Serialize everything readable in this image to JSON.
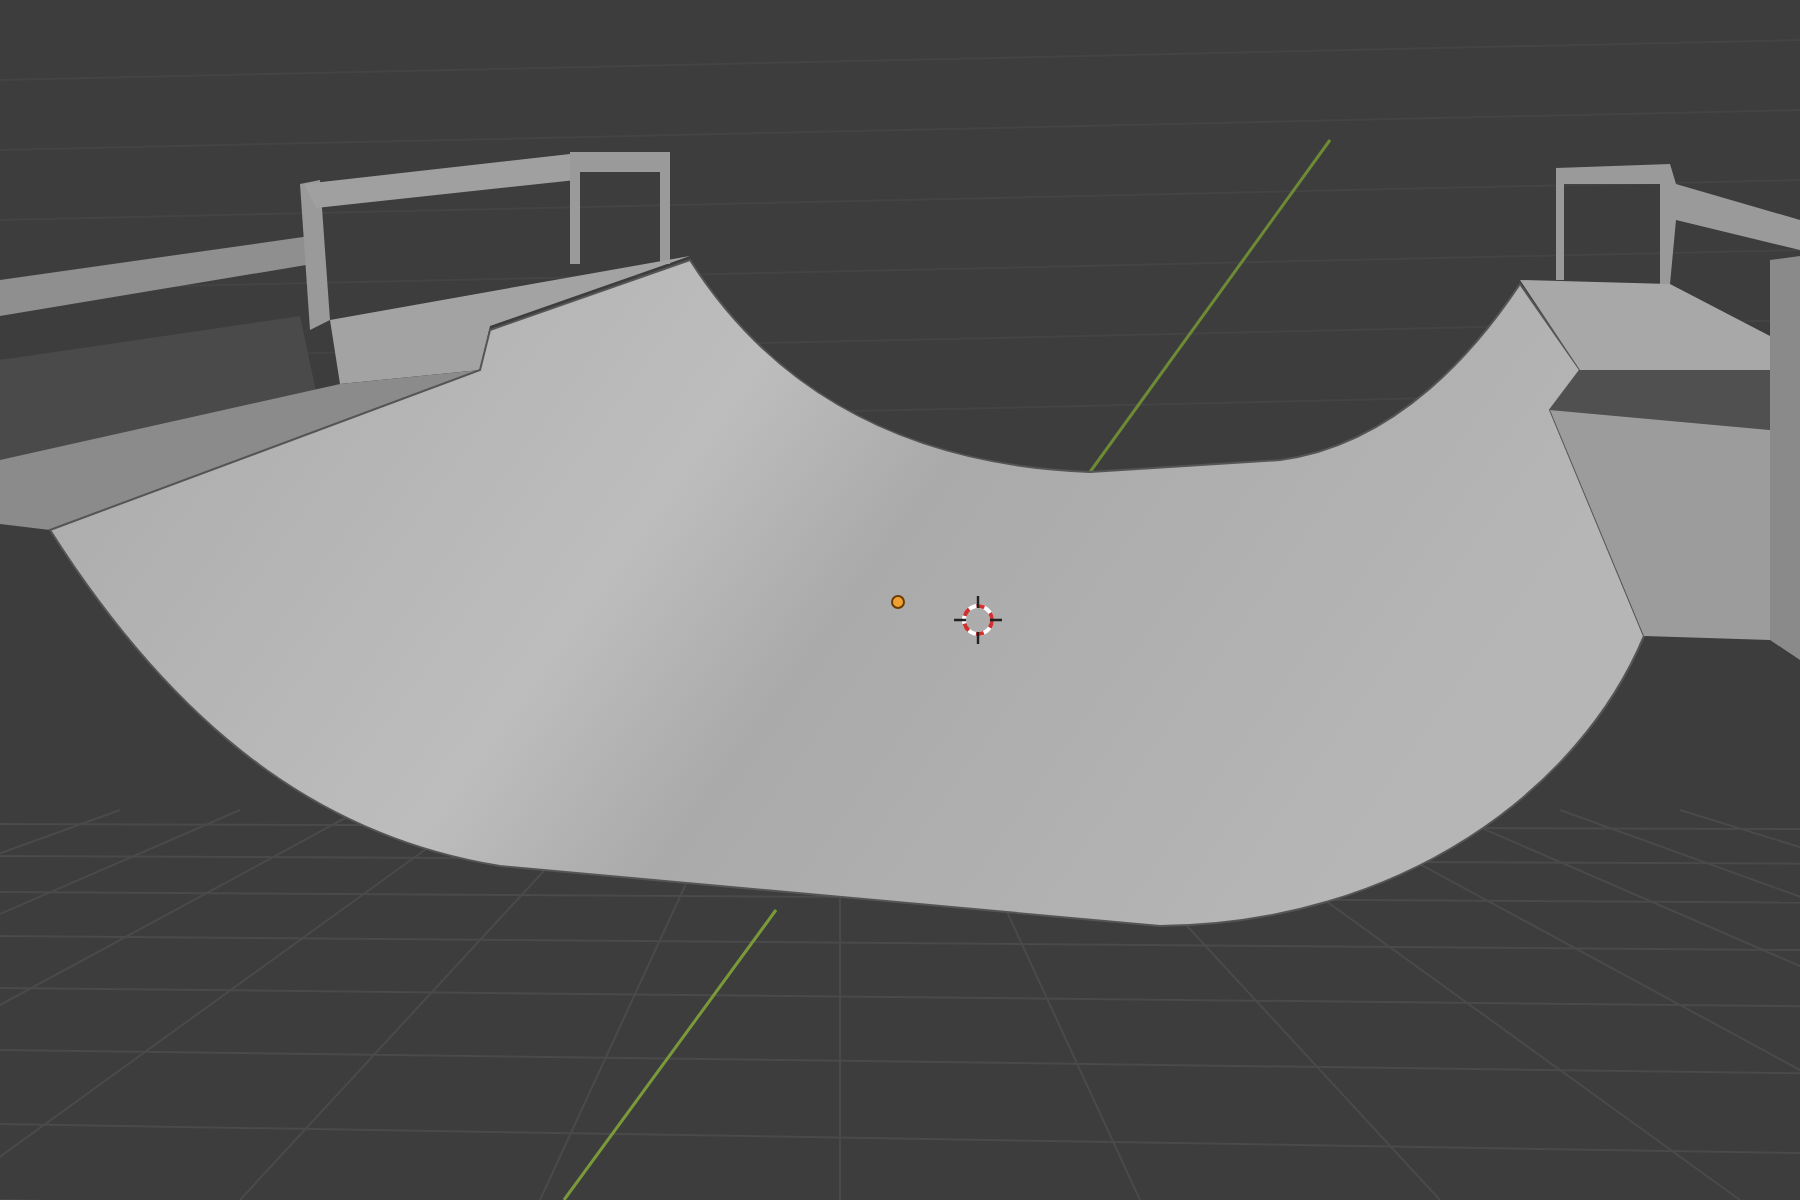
{
  "viewport": {
    "show_grid": true,
    "show_axis": true,
    "show_3d_cursor": true,
    "show_origin": true
  }
}
